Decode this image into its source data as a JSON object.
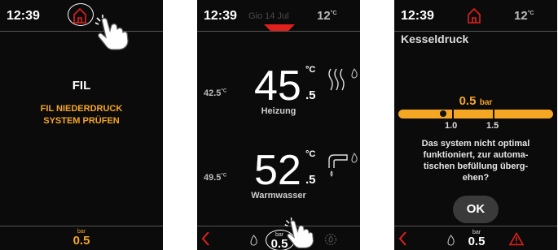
{
  "screens": [
    {
      "header": {
        "time": "12:39",
        "home_icon": "home-icon"
      },
      "alert": {
        "title": "FIL",
        "message_line1": "FIL NIEDERDRUCK",
        "message_line2": "SYSTEM PRÜFEN"
      },
      "footer": {
        "pressure_unit": "bar",
        "pressure_value": "0.5"
      }
    },
    {
      "header": {
        "time": "12:39",
        "date": "Gio 14 Jul",
        "outdoor_temp": "12",
        "outdoor_unit": "°C"
      },
      "heating": {
        "setpoint": "42.5",
        "setpoint_unit": "°C",
        "value": "45",
        "decimal": ".5",
        "unit": "°C",
        "label": "Heizung"
      },
      "dhw": {
        "setpoint": "49.5",
        "setpoint_unit": "°C",
        "value": "52",
        "decimal": ".5",
        "unit": "°C",
        "label": "Warmwasser"
      },
      "footer": {
        "pressure_unit": "bar",
        "pressure_value": "0.5"
      }
    },
    {
      "header": {
        "time": "12:39",
        "outdoor_temp": "12",
        "outdoor_unit": "°C"
      },
      "title": "Kesseldruck",
      "gauge": {
        "value": "0.5",
        "unit": "bar",
        "tick1": "1.0",
        "tick2": "1.5",
        "level_fraction": 0.5
      },
      "message": "Das system nicht optimal\nfunktioniert, zur automa-\ntischen befüllung überg-\nehen?",
      "ok_label": "OK",
      "footer": {
        "pressure_unit": "bar",
        "pressure_value": "0.5"
      }
    }
  ],
  "colors": {
    "accent": "#f5a623",
    "alert_red": "#e0201c",
    "background": "#0b0b0b"
  }
}
